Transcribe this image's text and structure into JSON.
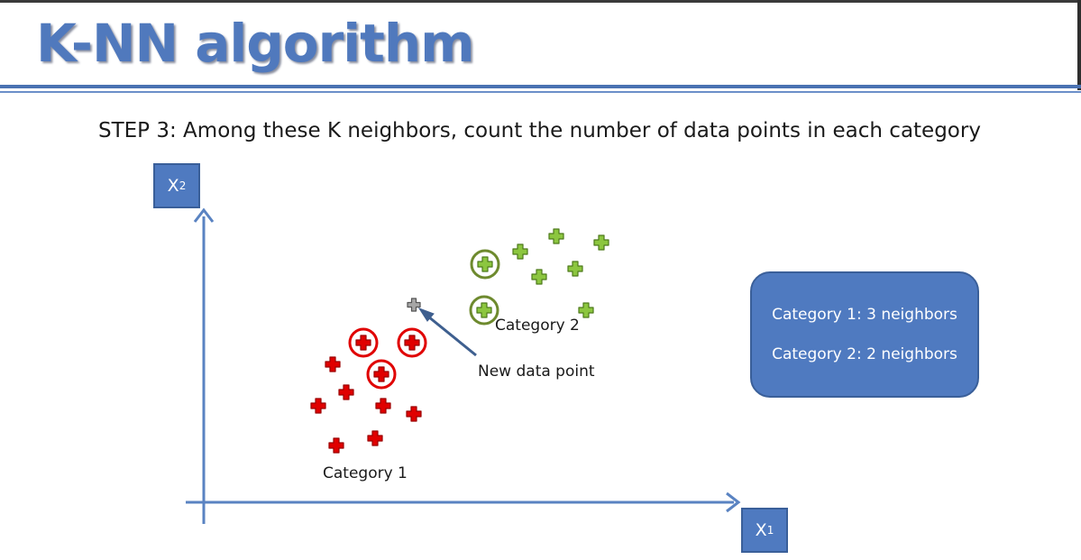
{
  "title": "K-NN algorithm",
  "step_text": "STEP 3: Among these K neighbors, count the number of data points in each category",
  "axes": {
    "y_label": "X",
    "y_sub": "2",
    "x_label": "X",
    "x_sub": "1"
  },
  "labels": {
    "category1": "Category 1",
    "category2": "Category 2",
    "new_point": "New data point"
  },
  "summary": {
    "line1": "Category 1: 3 neighbors",
    "line2": "Category 2: 2 neighbors"
  },
  "colors": {
    "accent_blue": "#4f7ac0",
    "category1": "#e00000",
    "category2": "#8cc63f",
    "category2_circle": "#6e8a2e",
    "new_point": "#a6a6a6",
    "arrow": "#3e5f8f"
  },
  "icons": {
    "category1_point": "red-plus-icon",
    "category2_point": "green-plus-icon",
    "new_point": "gray-plus-icon"
  }
}
